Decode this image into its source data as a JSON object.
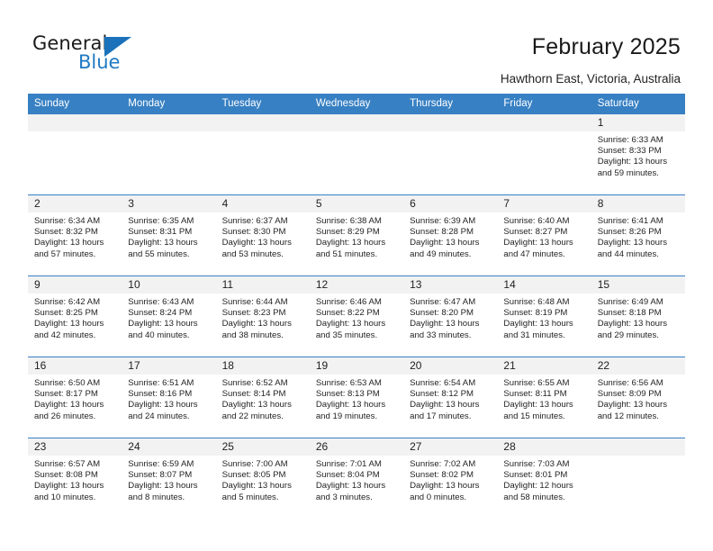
{
  "brand": {
    "name_top": "General",
    "name_bottom": "Blue",
    "accent_color": "#1b72ba",
    "flag_icon": "triangle-flag-icon"
  },
  "header": {
    "title": "February 2025",
    "subtitle": "Hawthorn East, Victoria, Australia"
  },
  "calendar": {
    "header_bg": "#3780c3",
    "daynum_bg": "#f2f2f2",
    "weekdays": [
      "Sunday",
      "Monday",
      "Tuesday",
      "Wednesday",
      "Thursday",
      "Friday",
      "Saturday"
    ],
    "weeks": [
      [
        {
          "day": "",
          "sunrise": "",
          "sunset": "",
          "daylight": "",
          "daylight2": ""
        },
        {
          "day": "",
          "sunrise": "",
          "sunset": "",
          "daylight": "",
          "daylight2": ""
        },
        {
          "day": "",
          "sunrise": "",
          "sunset": "",
          "daylight": "",
          "daylight2": ""
        },
        {
          "day": "",
          "sunrise": "",
          "sunset": "",
          "daylight": "",
          "daylight2": ""
        },
        {
          "day": "",
          "sunrise": "",
          "sunset": "",
          "daylight": "",
          "daylight2": ""
        },
        {
          "day": "",
          "sunrise": "",
          "sunset": "",
          "daylight": "",
          "daylight2": ""
        },
        {
          "day": "1",
          "sunrise": "Sunrise: 6:33 AM",
          "sunset": "Sunset: 8:33 PM",
          "daylight": "Daylight: 13 hours",
          "daylight2": "and 59 minutes."
        }
      ],
      [
        {
          "day": "2",
          "sunrise": "Sunrise: 6:34 AM",
          "sunset": "Sunset: 8:32 PM",
          "daylight": "Daylight: 13 hours",
          "daylight2": "and 57 minutes."
        },
        {
          "day": "3",
          "sunrise": "Sunrise: 6:35 AM",
          "sunset": "Sunset: 8:31 PM",
          "daylight": "Daylight: 13 hours",
          "daylight2": "and 55 minutes."
        },
        {
          "day": "4",
          "sunrise": "Sunrise: 6:37 AM",
          "sunset": "Sunset: 8:30 PM",
          "daylight": "Daylight: 13 hours",
          "daylight2": "and 53 minutes."
        },
        {
          "day": "5",
          "sunrise": "Sunrise: 6:38 AM",
          "sunset": "Sunset: 8:29 PM",
          "daylight": "Daylight: 13 hours",
          "daylight2": "and 51 minutes."
        },
        {
          "day": "6",
          "sunrise": "Sunrise: 6:39 AM",
          "sunset": "Sunset: 8:28 PM",
          "daylight": "Daylight: 13 hours",
          "daylight2": "and 49 minutes."
        },
        {
          "day": "7",
          "sunrise": "Sunrise: 6:40 AM",
          "sunset": "Sunset: 8:27 PM",
          "daylight": "Daylight: 13 hours",
          "daylight2": "and 47 minutes."
        },
        {
          "day": "8",
          "sunrise": "Sunrise: 6:41 AM",
          "sunset": "Sunset: 8:26 PM",
          "daylight": "Daylight: 13 hours",
          "daylight2": "and 44 minutes."
        }
      ],
      [
        {
          "day": "9",
          "sunrise": "Sunrise: 6:42 AM",
          "sunset": "Sunset: 8:25 PM",
          "daylight": "Daylight: 13 hours",
          "daylight2": "and 42 minutes."
        },
        {
          "day": "10",
          "sunrise": "Sunrise: 6:43 AM",
          "sunset": "Sunset: 8:24 PM",
          "daylight": "Daylight: 13 hours",
          "daylight2": "and 40 minutes."
        },
        {
          "day": "11",
          "sunrise": "Sunrise: 6:44 AM",
          "sunset": "Sunset: 8:23 PM",
          "daylight": "Daylight: 13 hours",
          "daylight2": "and 38 minutes."
        },
        {
          "day": "12",
          "sunrise": "Sunrise: 6:46 AM",
          "sunset": "Sunset: 8:22 PM",
          "daylight": "Daylight: 13 hours",
          "daylight2": "and 35 minutes."
        },
        {
          "day": "13",
          "sunrise": "Sunrise: 6:47 AM",
          "sunset": "Sunset: 8:20 PM",
          "daylight": "Daylight: 13 hours",
          "daylight2": "and 33 minutes."
        },
        {
          "day": "14",
          "sunrise": "Sunrise: 6:48 AM",
          "sunset": "Sunset: 8:19 PM",
          "daylight": "Daylight: 13 hours",
          "daylight2": "and 31 minutes."
        },
        {
          "day": "15",
          "sunrise": "Sunrise: 6:49 AM",
          "sunset": "Sunset: 8:18 PM",
          "daylight": "Daylight: 13 hours",
          "daylight2": "and 29 minutes."
        }
      ],
      [
        {
          "day": "16",
          "sunrise": "Sunrise: 6:50 AM",
          "sunset": "Sunset: 8:17 PM",
          "daylight": "Daylight: 13 hours",
          "daylight2": "and 26 minutes."
        },
        {
          "day": "17",
          "sunrise": "Sunrise: 6:51 AM",
          "sunset": "Sunset: 8:16 PM",
          "daylight": "Daylight: 13 hours",
          "daylight2": "and 24 minutes."
        },
        {
          "day": "18",
          "sunrise": "Sunrise: 6:52 AM",
          "sunset": "Sunset: 8:14 PM",
          "daylight": "Daylight: 13 hours",
          "daylight2": "and 22 minutes."
        },
        {
          "day": "19",
          "sunrise": "Sunrise: 6:53 AM",
          "sunset": "Sunset: 8:13 PM",
          "daylight": "Daylight: 13 hours",
          "daylight2": "and 19 minutes."
        },
        {
          "day": "20",
          "sunrise": "Sunrise: 6:54 AM",
          "sunset": "Sunset: 8:12 PM",
          "daylight": "Daylight: 13 hours",
          "daylight2": "and 17 minutes."
        },
        {
          "day": "21",
          "sunrise": "Sunrise: 6:55 AM",
          "sunset": "Sunset: 8:11 PM",
          "daylight": "Daylight: 13 hours",
          "daylight2": "and 15 minutes."
        },
        {
          "day": "22",
          "sunrise": "Sunrise: 6:56 AM",
          "sunset": "Sunset: 8:09 PM",
          "daylight": "Daylight: 13 hours",
          "daylight2": "and 12 minutes."
        }
      ],
      [
        {
          "day": "23",
          "sunrise": "Sunrise: 6:57 AM",
          "sunset": "Sunset: 8:08 PM",
          "daylight": "Daylight: 13 hours",
          "daylight2": "and 10 minutes."
        },
        {
          "day": "24",
          "sunrise": "Sunrise: 6:59 AM",
          "sunset": "Sunset: 8:07 PM",
          "daylight": "Daylight: 13 hours",
          "daylight2": "and 8 minutes."
        },
        {
          "day": "25",
          "sunrise": "Sunrise: 7:00 AM",
          "sunset": "Sunset: 8:05 PM",
          "daylight": "Daylight: 13 hours",
          "daylight2": "and 5 minutes."
        },
        {
          "day": "26",
          "sunrise": "Sunrise: 7:01 AM",
          "sunset": "Sunset: 8:04 PM",
          "daylight": "Daylight: 13 hours",
          "daylight2": "and 3 minutes."
        },
        {
          "day": "27",
          "sunrise": "Sunrise: 7:02 AM",
          "sunset": "Sunset: 8:02 PM",
          "daylight": "Daylight: 13 hours",
          "daylight2": "and 0 minutes."
        },
        {
          "day": "28",
          "sunrise": "Sunrise: 7:03 AM",
          "sunset": "Sunset: 8:01 PM",
          "daylight": "Daylight: 12 hours",
          "daylight2": "and 58 minutes."
        },
        {
          "day": "",
          "sunrise": "",
          "sunset": "",
          "daylight": "",
          "daylight2": ""
        }
      ]
    ]
  }
}
